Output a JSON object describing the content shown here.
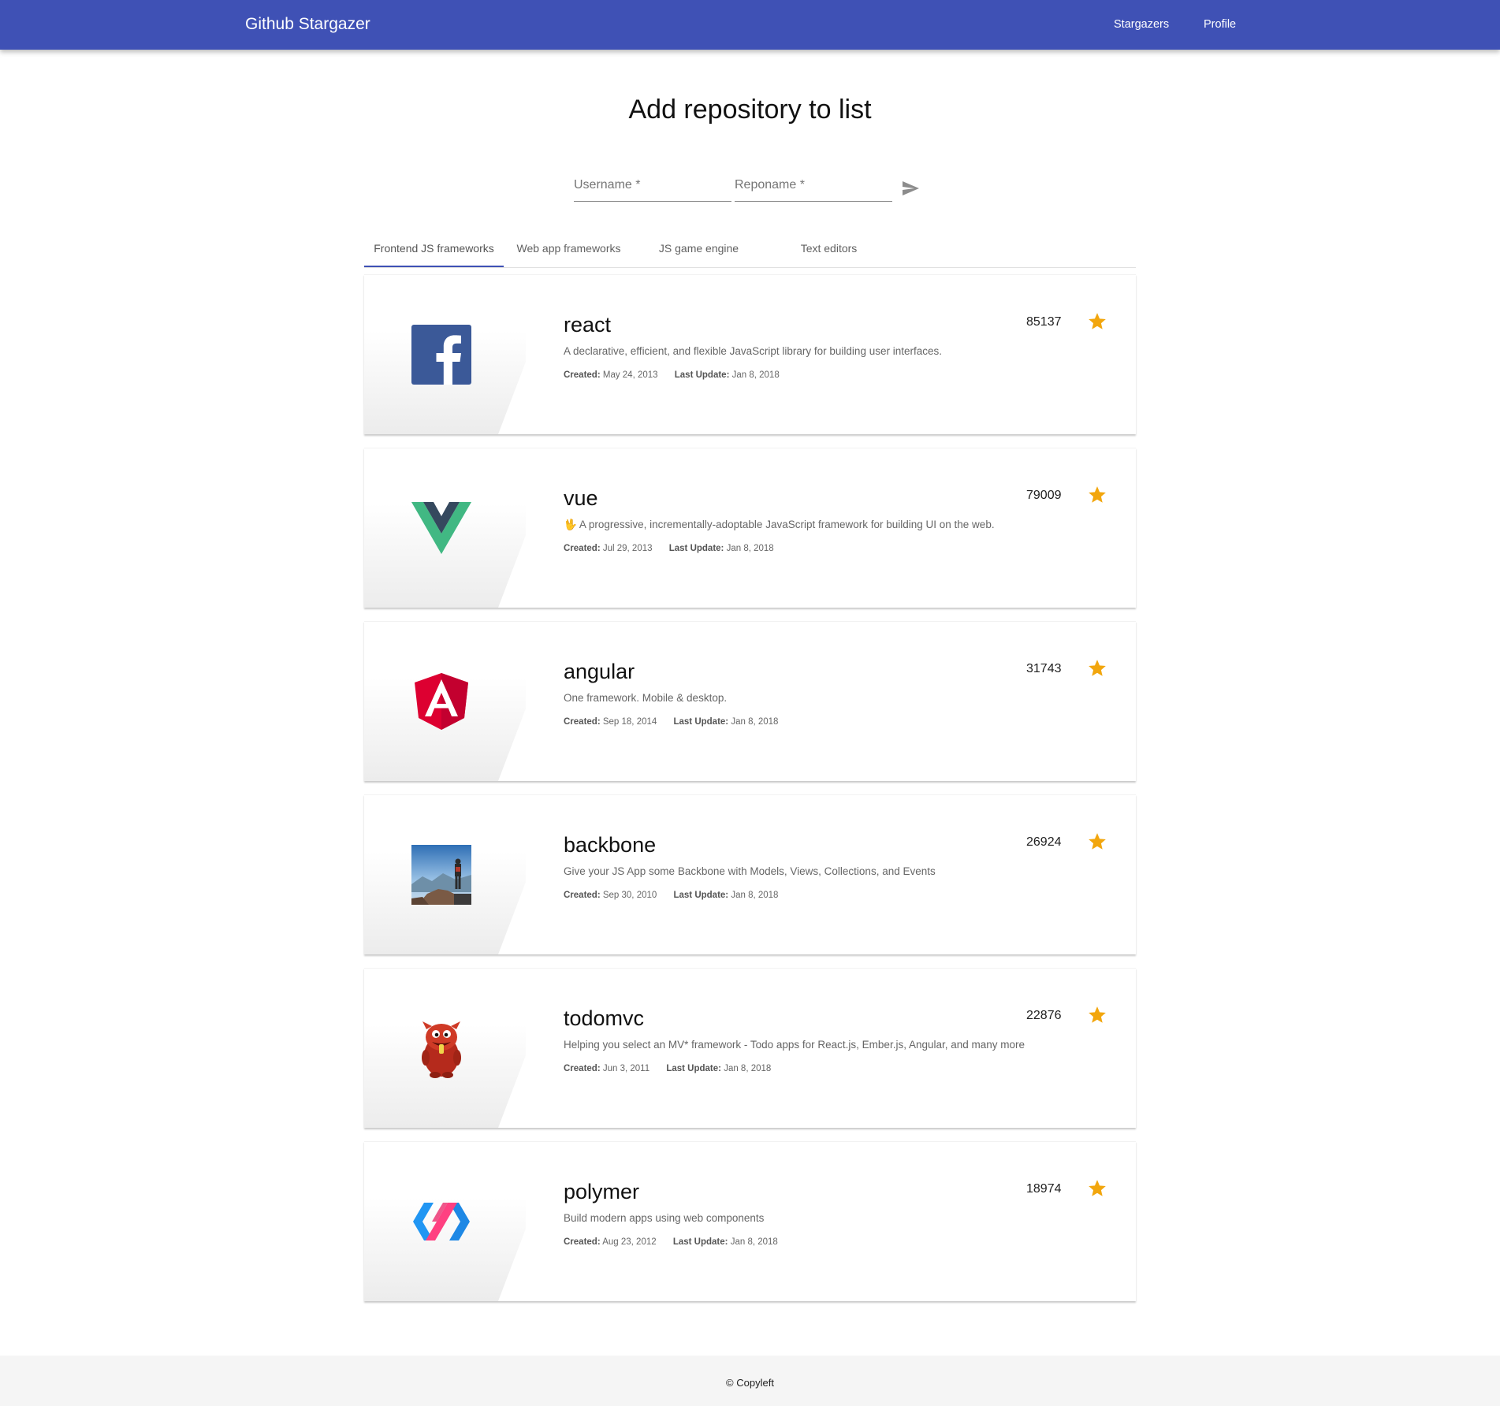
{
  "header": {
    "title": "Github Stargazer",
    "nav": [
      "Stargazers",
      "Profile"
    ],
    "accent_color": "#3f51b5"
  },
  "page": {
    "heading": "Add repository to list"
  },
  "form": {
    "username_placeholder": "Username *",
    "reponame_placeholder": "Reponame *",
    "submit_icon": "send-icon"
  },
  "tabs": {
    "items": [
      "Frontend JS frameworks",
      "Web app frameworks",
      "JS game engine",
      "Text editors"
    ],
    "selected": "Frontend JS frameworks"
  },
  "repos": [
    {
      "name": "react",
      "description": "A declarative, efficient, and flexible JavaScript library for building user interfaces.",
      "created_label": "Created:",
      "created": "May 24, 2013",
      "updated_label": "Last Update:",
      "updated": "Jan 8, 2018",
      "stars": "85137",
      "logo": "facebook-logo"
    },
    {
      "name": "vue",
      "description": "🖖 A progressive, incrementally-adoptable JavaScript framework for building UI on the web.",
      "created_label": "Created:",
      "created": "Jul 29, 2013",
      "updated_label": "Last Update:",
      "updated": "Jan 8, 2018",
      "stars": "79009",
      "logo": "vue-logo"
    },
    {
      "name": "angular",
      "description": "One framework. Mobile & desktop.",
      "created_label": "Created:",
      "created": "Sep 18, 2014",
      "updated_label": "Last Update:",
      "updated": "Jan 8, 2018",
      "stars": "31743",
      "logo": "angular-logo"
    },
    {
      "name": "backbone",
      "description": "Give your JS App some Backbone with Models, Views, Collections, and Events",
      "created_label": "Created:",
      "created": "Sep 30, 2010",
      "updated_label": "Last Update:",
      "updated": "Jan 8, 2018",
      "stars": "26924",
      "logo": "mountain-photo"
    },
    {
      "name": "todomvc",
      "description": "Helping you select an MV* framework - Todo apps for React.js, Ember.js, Angular, and many more",
      "created_label": "Created:",
      "created": "Jun 3, 2011",
      "updated_label": "Last Update:",
      "updated": "Jan 8, 2018",
      "stars": "22876",
      "logo": "red-monster-logo"
    },
    {
      "name": "polymer",
      "description": "Build modern apps using web components",
      "created_label": "Created:",
      "created": "Aug 23, 2012",
      "updated_label": "Last Update:",
      "updated": "Jan 8, 2018",
      "stars": "18974",
      "logo": "polymer-logo"
    }
  ],
  "star_color": "#f2a60d",
  "footer": {
    "text": "© Copyleft"
  }
}
